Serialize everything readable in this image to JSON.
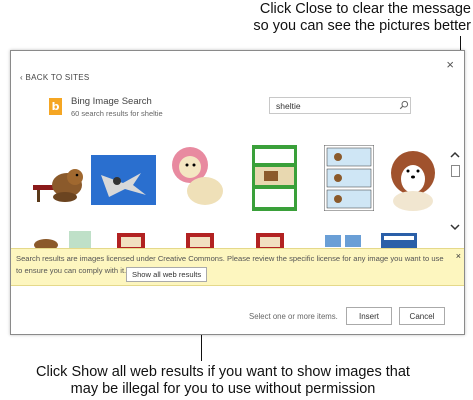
{
  "callouts": {
    "top_line1": "Click Close to clear the message",
    "top_line2": "so you can see the pictures better",
    "bottom_line1": "Click Show all web results if you want to show images that",
    "bottom_line2": "may be illegal for you to use without permission"
  },
  "dialog": {
    "close_glyph": "×",
    "back_link": "‹ BACK TO SITES",
    "provider_title": "Bing Image Search",
    "provider_subtitle": "60 search results for sheltie",
    "search_value": "sheltie",
    "warning_text": "Search results are images licensed under Creative Commons. Please review the specific license for any image you want to use to ensure you can comply with it.",
    "warning_close_glyph": "×",
    "show_all_label": "Show all web results",
    "status_text": "Select one or more items.",
    "insert_label": "Insert",
    "cancel_label": "Cancel"
  },
  "icons": {
    "logo": "bing-logo-icon",
    "search": "search-icon",
    "scroll_up": "chevron-up-icon",
    "scroll_down": "chevron-down-icon"
  },
  "colors": {
    "bing_orange": "#f5a623",
    "warning_bg": "#fdf6bf"
  }
}
